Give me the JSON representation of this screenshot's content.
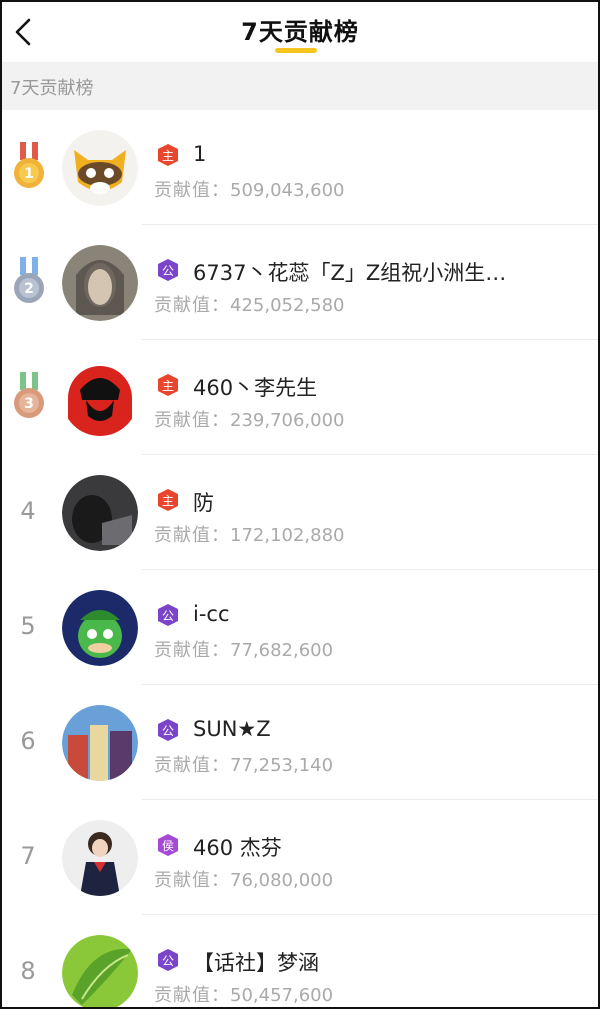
{
  "header": {
    "title": "7天贡献榜"
  },
  "section": {
    "label": "7天贡献榜"
  },
  "value_label": "贡献值：",
  "entries": [
    {
      "rank": "1",
      "name": "1",
      "value": "509,043,600",
      "badge": "主",
      "badge_color": "#e8462e"
    },
    {
      "rank": "2",
      "name": "6737丶花蕊「Z」Z组祝小洲生…",
      "value": "425,052,580",
      "badge": "公",
      "badge_color": "#7b45c9"
    },
    {
      "rank": "3",
      "name": "460丶李先生",
      "value": "239,706,000",
      "badge": "主",
      "badge_color": "#e8462e"
    },
    {
      "rank": "4",
      "name": "防",
      "value": "172,102,880",
      "badge": "主",
      "badge_color": "#e8462e"
    },
    {
      "rank": "5",
      "name": "i-cc",
      "value": "77,682,600",
      "badge": "公",
      "badge_color": "#7b45c9"
    },
    {
      "rank": "6",
      "name": "SUN★Z",
      "value": "77,253,140",
      "badge": "公",
      "badge_color": "#7b45c9"
    },
    {
      "rank": "7",
      "name": "460 杰芬",
      "value": "76,080,000",
      "badge": "侯",
      "badge_color": "#a64ad6"
    },
    {
      "rank": "8",
      "name": "【话社】梦涵",
      "value": "50,457,600",
      "badge": "公",
      "badge_color": "#7b45c9"
    }
  ],
  "colors": {
    "accent": "#f7c520",
    "gold": "#f0b23a",
    "silver": "#9aa6b8",
    "bronze": "#d89a7a"
  }
}
